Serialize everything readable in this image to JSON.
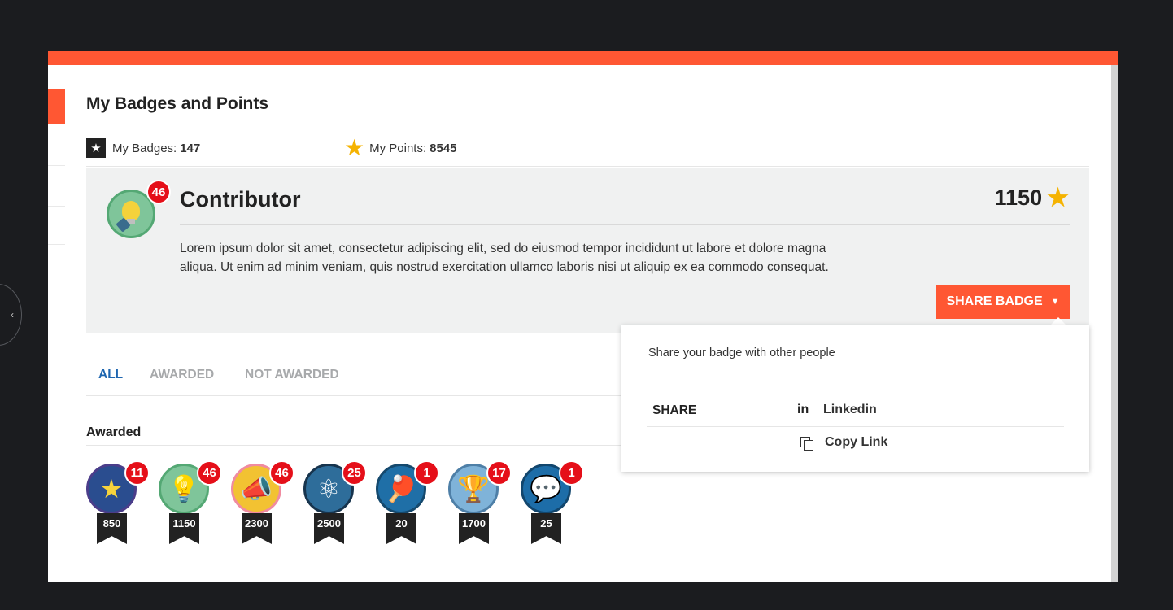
{
  "page": {
    "title": "My Badges and Points",
    "stats": {
      "badges_label": "My Badges:",
      "badges_value": "147",
      "points_label": "My Points:",
      "points_value": "8545"
    }
  },
  "detail": {
    "name": "Contributor",
    "count": "46",
    "points": "1150",
    "description": "Lorem ipsum dolor sit amet, consectetur adipiscing elit, sed do eiusmod tempor incididunt ut labore et dolore magna aliqua. Ut enim ad minim veniam, quis nostrud exercitation ullamco laboris nisi ut aliquip ex ea commodo consequat.",
    "share_button": "SHARE BADGE"
  },
  "tabs": [
    {
      "label": "ALL",
      "active": true
    },
    {
      "label": "AWARDED",
      "active": false
    },
    {
      "label": "NOT AWARDED",
      "active": false
    }
  ],
  "section_label": "Awarded",
  "badges": [
    {
      "icon": "star-icon",
      "count": "11",
      "points": "850",
      "bg": "#2a4d8f",
      "border": "#4b3d8a",
      "glyph": "★",
      "glyph_color": "#f6d33c"
    },
    {
      "icon": "lightbulb-icon",
      "count": "46",
      "points": "1150",
      "bg": "#7fc59a",
      "border": "#54a874",
      "glyph": "💡",
      "glyph_color": "#f4d23b"
    },
    {
      "icon": "megaphone-icon",
      "count": "46",
      "points": "2300",
      "bg": "#f2c232",
      "border": "#f08ba0",
      "glyph": "📣",
      "glyph_color": "#ffffff"
    },
    {
      "icon": "atom-icon",
      "count": "25",
      "points": "2500",
      "bg": "#2e6d9a",
      "border": "#17344d",
      "glyph": "⚛",
      "glyph_color": "#ffffff"
    },
    {
      "icon": "ping-pong-icon",
      "count": "1",
      "points": "20",
      "bg": "#1f6fa7",
      "border": "#15496d",
      "glyph": "🏓",
      "glyph_color": "#e4583a"
    },
    {
      "icon": "trophy-icon",
      "count": "17",
      "points": "1700",
      "bg": "#7fb3d9",
      "border": "#4e7fa7",
      "glyph": "🏆",
      "glyph_color": "#e8a72a"
    },
    {
      "icon": "chat-bubble-icon",
      "count": "1",
      "points": "25",
      "bg": "#1d6da8",
      "border": "#12466d",
      "glyph": "💬",
      "glyph_color": "#ffffff"
    }
  ],
  "share_popup": {
    "message": "Share your badge with other people",
    "share_label": "SHARE",
    "options": [
      {
        "icon": "linkedin-icon",
        "glyph": "in",
        "label": "Linkedin"
      },
      {
        "icon": "copy-link-icon",
        "glyph": "",
        "label": "Copy Link"
      }
    ]
  },
  "colors": {
    "accent": "#ff5733",
    "active_tab": "#1e66b0",
    "count_badge": "#e50f19",
    "star": "#f5b301"
  }
}
